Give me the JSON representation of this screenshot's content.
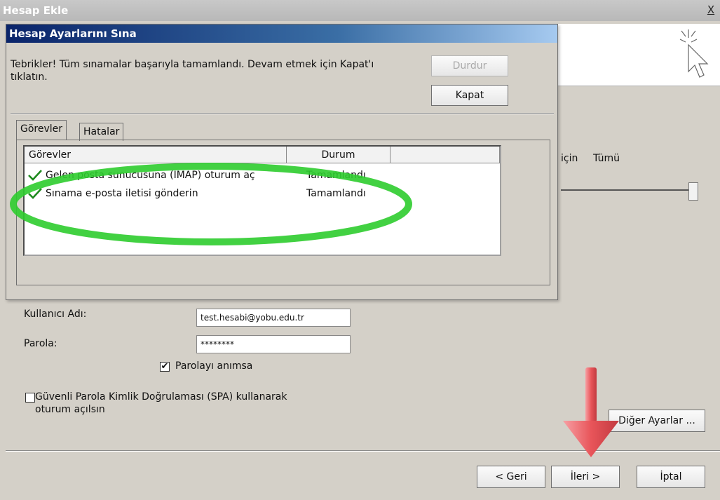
{
  "window": {
    "title": "Hesap Ekle",
    "close_label": "X"
  },
  "background_dialog": {
    "offline_label_icin": "için",
    "offline_label_tumu": "Tümü",
    "username_label": "Kullanıcı Adı:",
    "username_value": "test.hesabi@yobu.edu.tr",
    "password_label": "Parola:",
    "password_value": "********",
    "remember_password_label": "Parolayı anımsa",
    "remember_password_checked": "✔",
    "spa_label_line1": "Güvenli Parola Kimlik Doğrulaması (SPA) kullanarak",
    "spa_label_line2": "oturum açılsın",
    "more_settings_button": "Diğer Ayarlar ...",
    "back_button": "< Geri",
    "next_button": "İleri >",
    "cancel_button": "İptal"
  },
  "test_dialog": {
    "title": "Hesap Ayarlarını Sına",
    "message_line1": "Tebrikler! Tüm sınamalar başarıyla tamamlandı. Devam etmek için Kapat'ı",
    "message_line2": "tıklatın.",
    "stop_button": "Durdur",
    "close_button": "Kapat",
    "tabs": [
      {
        "label": "Görevler"
      },
      {
        "label": "Hatalar"
      }
    ],
    "columns": [
      "Görevler",
      "Durum",
      ""
    ],
    "rows": [
      {
        "task": "Gelen posta sunucusuna (IMAP) oturum aç",
        "status": "Tamamlandı"
      },
      {
        "task": "Sınama e-posta iletisi gönderin",
        "status": "Tamamlandı"
      }
    ]
  },
  "colors": {
    "highlight_ellipse": "#2ecc2e",
    "arrow": "#e8555a",
    "check": "#1e8a1e"
  }
}
